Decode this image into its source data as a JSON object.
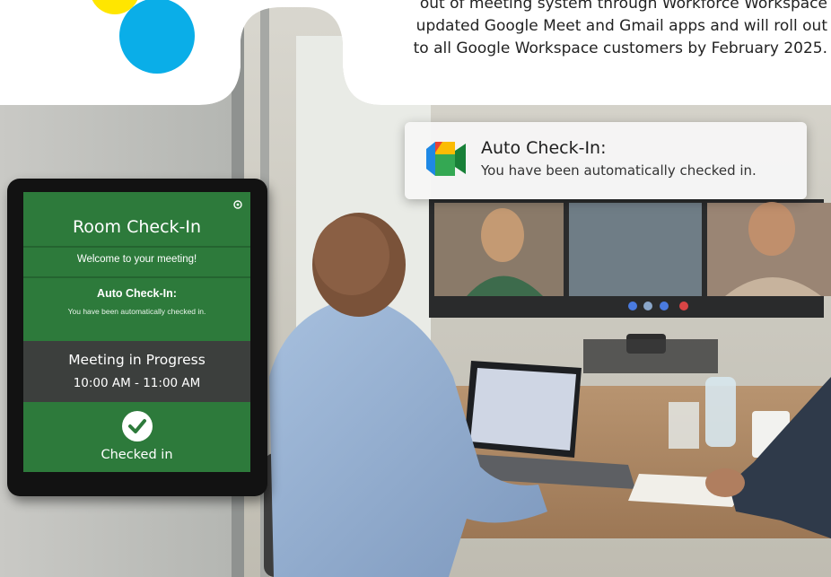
{
  "colors": {
    "dot_yellow": "#ffe600",
    "dot_blue": "#0aaee8",
    "screen_green": "#2d7a3b"
  },
  "caption": {
    "line1": "out of meeting system through Workforce Workspace",
    "line2": "updated Google Meet and Gmail apps and will roll out",
    "line3": "to all Google Workspace customers by February 2025."
  },
  "notification": {
    "icon": "google-meet-icon",
    "title": "Auto Check-In:",
    "body": "You have been automatically checked in."
  },
  "tablet": {
    "title": "Room Check-In",
    "welcome": "Welcome to your meeting!",
    "auto_title": "Auto Check-In:",
    "auto_body": "You have been automatically checked in.",
    "meeting_status": "Meeting in Progress",
    "meeting_time": "10:00 AM - 11:00 AM",
    "checked_label": "Checked in",
    "check_icon": "checkmark-icon"
  }
}
